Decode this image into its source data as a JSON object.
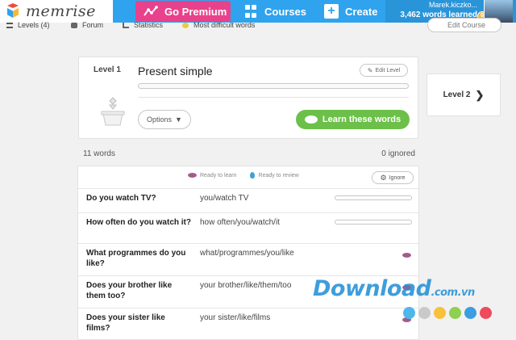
{
  "app": {
    "name": "memrise"
  },
  "nav": {
    "premium_label": "Go Premium",
    "courses_label": "Courses",
    "create_label": "Create"
  },
  "user": {
    "name": "Marek.kiczko...",
    "words_learned": "3,462 words learned",
    "badge": "6"
  },
  "subnav": {
    "levels": "Levels (4)",
    "forum": "Forum",
    "statistics": "Statistics",
    "difficult": "Most difficult words",
    "edit_course": "Edit Course"
  },
  "level": {
    "number": "Level 1",
    "title": "Present simple",
    "edit_label": "Edit Level",
    "options_label": "Options",
    "learn_label": "Learn these words",
    "next_label": "Level 2"
  },
  "summary": {
    "words": "11 words",
    "ignored": "0 ignored"
  },
  "legend": {
    "learn": "Ready to learn",
    "review": "Ready to review",
    "ignore": "Ignore"
  },
  "words": [
    {
      "q": "Do you watch TV?",
      "a": "you/watch TV",
      "status": "bar"
    },
    {
      "q": "How often do you watch it?",
      "a": "how often/you/watch/it",
      "status": "bar"
    },
    {
      "q": "What programmes do you like?",
      "a": "what/programmes/you/like",
      "status": "learn"
    },
    {
      "q": "Does your brother like them too?",
      "a": "your brother/like/them/too",
      "status": "learn"
    },
    {
      "q": "Does your sister like films?",
      "a": "your sister/like/films",
      "status": "learn"
    }
  ],
  "watermark": {
    "text": "Download",
    "suffix": ".com.vn"
  },
  "colors": {
    "topbar": "#2fa3ee",
    "premium": "#e8428c",
    "learn_button": "#6cc04a",
    "learn_dot": "#a45b8a",
    "review_drop": "#3ca0d8",
    "watermark_dots": [
      "#4fb7ec",
      "#c9c9c9",
      "#f7c13b",
      "#8fcf52",
      "#3c9ee0",
      "#ef4b5c"
    ]
  }
}
